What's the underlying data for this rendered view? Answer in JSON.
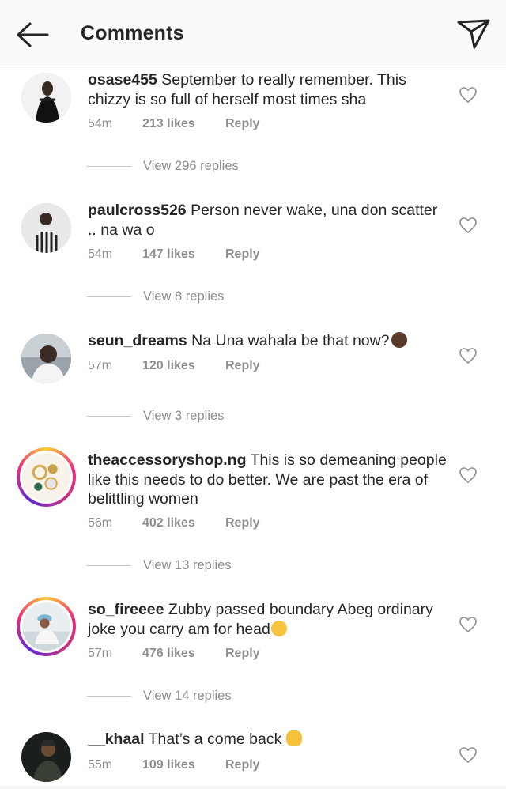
{
  "header": {
    "title": "Comments",
    "back_icon": "arrow-left-icon",
    "send_icon": "paper-plane-icon"
  },
  "colors": {
    "text": "#262626",
    "muted": "#8e8e8e",
    "header_bg": "#fafafa",
    "story_ring": "#ee2a7b"
  },
  "comments": [
    {
      "username": "osase455",
      "text": " September to really remember. This chizzy is so full of herself most times sha",
      "time": "54m",
      "likes": "213 likes",
      "reply": "Reply",
      "replies": "View 296 replies"
    },
    {
      "username": "paulcross526",
      "text": " Person never wake, una don scatter .. na wa o",
      "time": "54m",
      "likes": "147 likes",
      "reply": "Reply",
      "replies": "View 8 replies"
    },
    {
      "username": "seun_dreams",
      "text": " Na Una wahala be that now?",
      "time": "57m",
      "likes": "120 likes",
      "reply": "Reply",
      "replies": "View 3 replies"
    },
    {
      "username": "theaccessoryshop.ng",
      "text": " This is so demeaning people like this needs to do better. We are past the era of belittling women",
      "time": "56m",
      "likes": "402 likes",
      "reply": "Reply",
      "replies": "View 13 replies"
    },
    {
      "username": "so_fireeee",
      "text": " Zubby passed boundary Abeg ordinary joke you carry am for head",
      "time": "57m",
      "likes": "476 likes",
      "reply": "Reply",
      "replies": "View 14 replies"
    },
    {
      "username": "__khaal",
      "text": " That’s a come back ",
      "time": "55m",
      "likes": "109 likes",
      "reply": "Reply"
    }
  ]
}
